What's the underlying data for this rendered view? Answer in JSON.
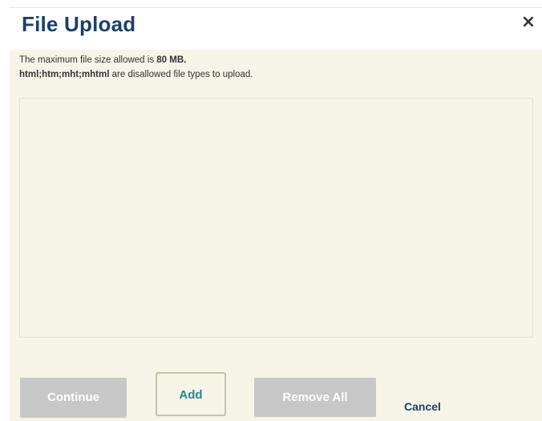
{
  "dialog": {
    "title": "File Upload",
    "close_label": "×",
    "info": {
      "max_size_prefix": "The maximum file size allowed is ",
      "max_size_value": "80 MB.",
      "disallowed_types": "html;htm;mht;mhtml",
      "disallowed_suffix": " are disallowed file types to upload."
    },
    "buttons": {
      "continue_label": "Continue",
      "add_label": "Add",
      "remove_all_label": "Remove All",
      "cancel_label": "Cancel"
    }
  },
  "colors": {
    "title": "#1b3f6b",
    "panel_background": "#f7f4e8",
    "disabled_button": "#c7c7c7",
    "add_text": "#1f8a8a",
    "add_border": "#c9c2ac"
  }
}
